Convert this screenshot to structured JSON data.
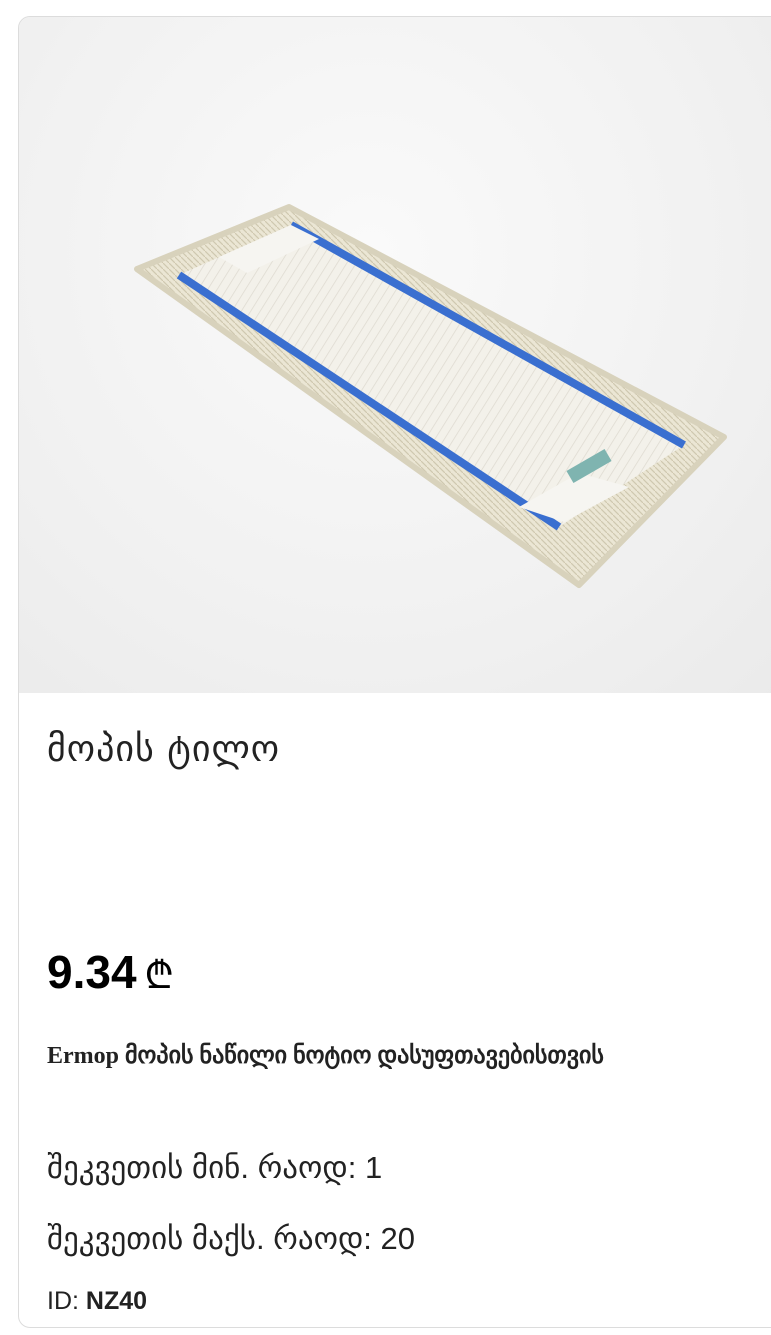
{
  "product": {
    "image_alt": "mop pad",
    "title": "მოპის ტილო",
    "price": "9.34",
    "currency_symbol": "₾",
    "description": "Ermop მოპის ნაწილი ნოტიო დასუფთავებისთვის",
    "min_qty_text": "შეკვეთის მინ. რაოდ: 1",
    "max_qty_text": "შეკვეთის მაქს. რაოდ: 20",
    "id_label": "ID:",
    "id_value": "NZ40"
  },
  "colors": {
    "stripe_blue": "#3a6fd0",
    "fringe": "#e8e3d2",
    "pad": "#f4f2ec"
  }
}
